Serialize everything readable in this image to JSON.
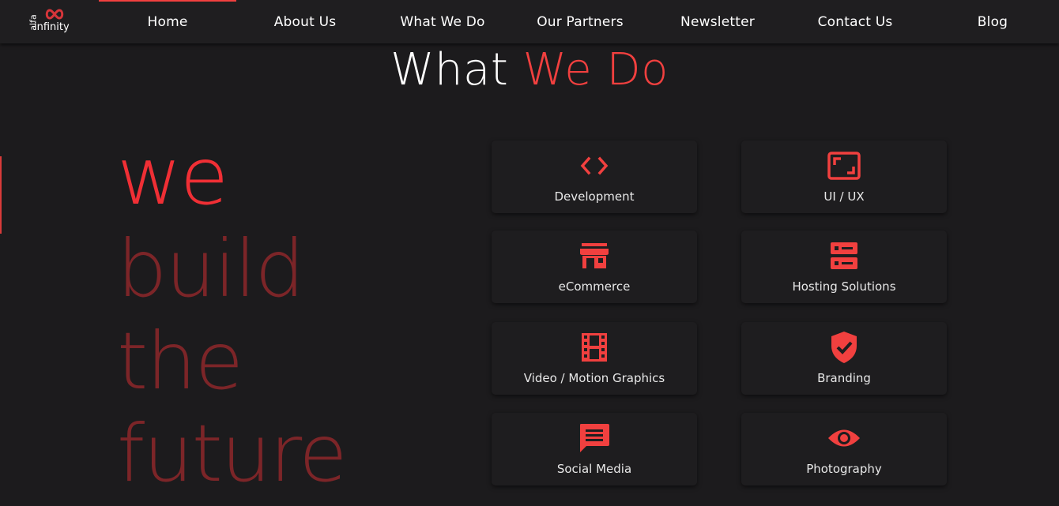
{
  "brand": {
    "logo_top": "alfa",
    "logo_bottom": "infinity"
  },
  "nav": {
    "items": [
      {
        "label": "Home",
        "active": true
      },
      {
        "label": "About Us"
      },
      {
        "label": "What We Do"
      },
      {
        "label": "Our Partners"
      },
      {
        "label": "Newsletter"
      },
      {
        "label": "Contact Us"
      },
      {
        "label": "Blog"
      }
    ]
  },
  "section": {
    "title_white": "What",
    "title_red": "We Do"
  },
  "slogan": {
    "line1": "we",
    "line2": "build",
    "line3": "the",
    "line4": "future"
  },
  "services": [
    {
      "label": "Development",
      "icon": "code-icon"
    },
    {
      "label": "UI / UX",
      "icon": "aspect-ratio-icon"
    },
    {
      "label": "eCommerce",
      "icon": "store-icon"
    },
    {
      "label": "Hosting Solutions",
      "icon": "server-icon"
    },
    {
      "label": "Video / Motion Graphics",
      "icon": "film-icon"
    },
    {
      "label": "Branding",
      "icon": "shield-check-icon"
    },
    {
      "label": "Social Media",
      "icon": "chat-icon"
    },
    {
      "label": "Photography",
      "icon": "eye-icon"
    }
  ],
  "colors": {
    "accent": "#f1403f",
    "background": "#1c1b1d",
    "slogan_dim": "#7c2528"
  }
}
